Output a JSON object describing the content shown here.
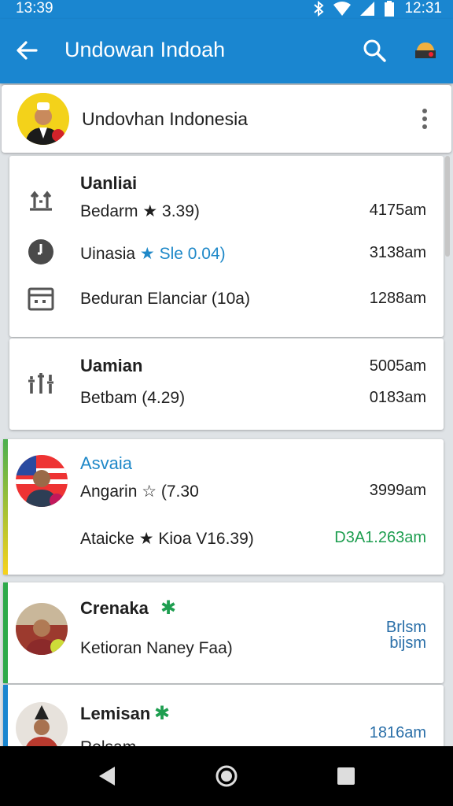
{
  "status_bar": {
    "time": "13:39",
    "time_right": "12:31"
  },
  "app_bar": {
    "title": "Undowan Indoah"
  },
  "profile": {
    "name": "Undovhan Indonesia"
  },
  "sections": [
    {
      "rows": [
        {
          "title": "Uanliai",
          "line": "Bedarm ★ 3.39)",
          "value": "4175am"
        },
        {
          "line_prefix": "Uinasia",
          "line_highlight": "Sle 0.04)",
          "value": "3138am"
        },
        {
          "line": "Beduran Elanciar (10a)",
          "value": "1288am"
        }
      ]
    },
    {
      "rows": [
        {
          "title": "Uamian",
          "value": "5005am"
        },
        {
          "line": "Betbam (4.29)",
          "value": "0183am"
        }
      ]
    }
  ],
  "contacts": [
    {
      "name": "Asvaia",
      "line1": "Angarin ☆ (7.30",
      "value1": "3999am",
      "line2": "Ataicke ★ Kioa V16.39)",
      "value2": "D3A1.263am"
    },
    {
      "name": "Crenaka",
      "star": "✱",
      "line1": "Ketioran Naney Faa)",
      "value1a": "Brlsm",
      "value1b": "bijsm"
    },
    {
      "name": "Lemisan",
      "star": "✱",
      "line1": "Relsam",
      "value1": "1816am"
    }
  ],
  "colors": {
    "primary": "#1a86d0",
    "accent_blue": "#1e88c8",
    "green": "#1e9e50"
  },
  "icons": [
    "back-arrow-icon",
    "search-icon",
    "account-icon",
    "more-vert-icon",
    "transfer-icon",
    "clock-icon",
    "calendar-icon",
    "equalizer-icon"
  ]
}
